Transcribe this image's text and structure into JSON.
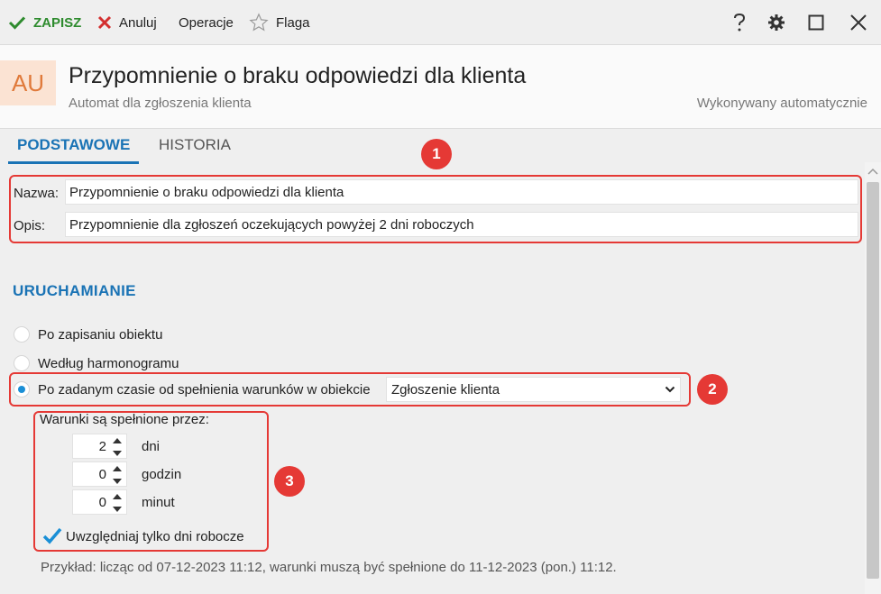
{
  "toolbar": {
    "save_label": "ZAPISZ",
    "cancel_label": "Anuluj",
    "operations_label": "Operacje",
    "flag_label": "Flaga"
  },
  "header": {
    "avatar_text": "AU",
    "title": "Przypomnienie o braku odpowiedzi dla klienta",
    "subtitle": "Automat dla zgłoszenia klienta",
    "mode": "Wykonywany automatycznie"
  },
  "tabs": [
    {
      "label": "PODSTAWOWE",
      "active": true
    },
    {
      "label": "HISTORIA",
      "active": false
    }
  ],
  "annotations": [
    "1",
    "2",
    "3"
  ],
  "form": {
    "name_label": "Nazwa:",
    "name_value": "Przypomnienie o braku odpowiedzi dla klienta",
    "desc_label": "Opis:",
    "desc_value": "Przypomnienie dla zgłoszeń oczekujących powyżej 2 dni roboczych"
  },
  "trigger": {
    "section_title": "URUCHAMIANIE",
    "options": [
      {
        "label": "Po zapisaniu obiektu",
        "checked": false
      },
      {
        "label": "Według harmonogramu",
        "checked": false
      },
      {
        "label": "Po zadanym czasie od spełnienia warunków w obiekcie",
        "checked": true
      }
    ],
    "object_select": "Zgłoszenie klienta"
  },
  "conditions": {
    "heading": "Warunki są spełnione przez:",
    "days": {
      "value": "2",
      "unit": "dni"
    },
    "hours": {
      "value": "0",
      "unit": "godzin"
    },
    "minutes": {
      "value": "0",
      "unit": "minut"
    },
    "workdays_label": "Uwzględniaj tylko dni robocze",
    "workdays_checked": true
  },
  "example": "Przykład: licząc od 07-12-2023 11:12, warunki muszą być spełnione do 11-12-2023 (pon.) 11:12.",
  "colors": {
    "accent": "#1a73b5",
    "save": "#2e8b2e",
    "annotation": "#e53935",
    "avatar_bg": "#fbe3d3",
    "avatar_fg": "#e07a3b"
  },
  "icons": [
    "check-icon",
    "x-icon",
    "star-icon",
    "help-icon",
    "gear-icon",
    "maximize-icon",
    "close-icon"
  ]
}
